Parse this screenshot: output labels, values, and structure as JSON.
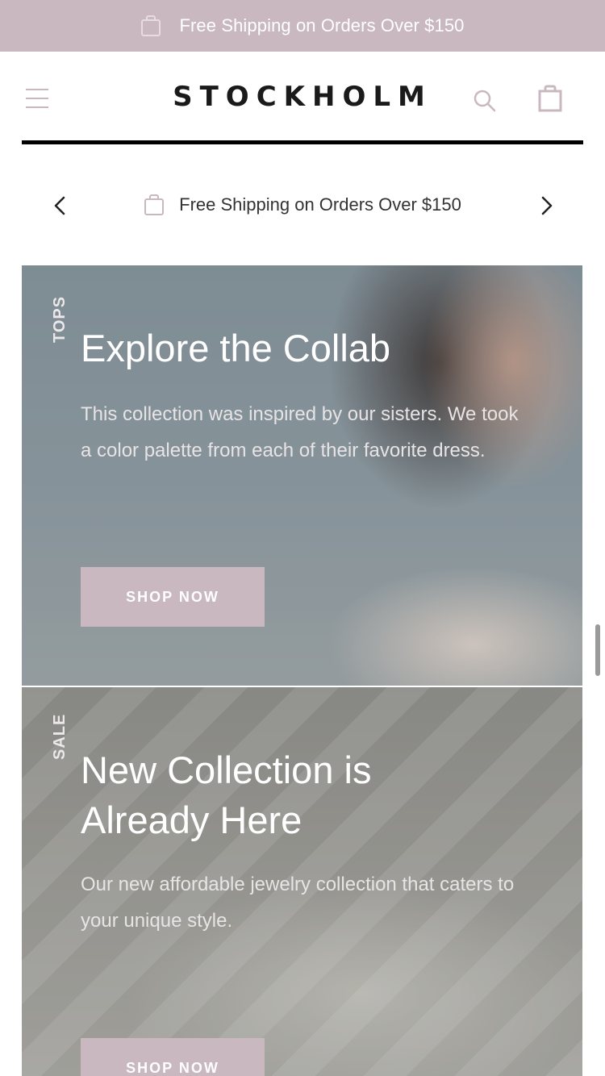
{
  "announcement": {
    "text": "Free Shipping on Orders Over $150",
    "icon": "shopping-bag-icon"
  },
  "header": {
    "logo": "STOCKHOLM",
    "menu_icon": "hamburger-icon",
    "search_icon": "search-icon",
    "cart_icon": "shopping-bag-icon"
  },
  "promo_slider": {
    "text": "Free Shipping on Orders Over $150",
    "prev_icon": "chevron-left-icon",
    "next_icon": "chevron-right-icon"
  },
  "banners": [
    {
      "tag": "TOPS",
      "title": "Explore the Collab",
      "description": "This collection was inspired by our sisters. We took a color palette from each of their favorite dress.",
      "button": "SHOP NOW"
    },
    {
      "tag": "SALE",
      "title": "New Collection is Already Here",
      "description_lines": [
        "Our new affordable jewelry collection that caters to",
        "your unique style."
      ],
      "button": "SHOP NOW"
    }
  ],
  "colors": {
    "accent": "#c9b8c0",
    "text_dark": "#1a1a1a",
    "white": "#ffffff"
  }
}
